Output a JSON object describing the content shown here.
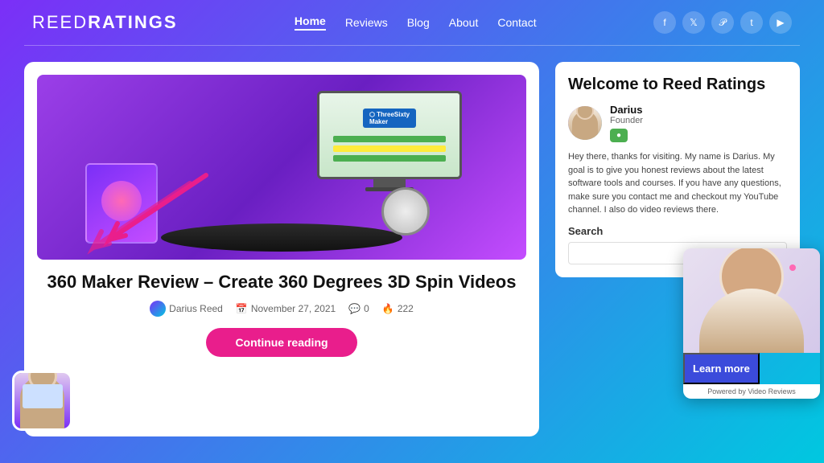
{
  "header": {
    "logo": "ReedRatings",
    "nav": {
      "items": [
        {
          "label": "Home",
          "active": true
        },
        {
          "label": "Reviews",
          "active": false
        },
        {
          "label": "Blog",
          "active": false
        },
        {
          "label": "About",
          "active": false
        },
        {
          "label": "Contact",
          "active": false
        }
      ]
    },
    "social": [
      "f",
      "t",
      "p",
      "t",
      "yt"
    ]
  },
  "article": {
    "title": "360 Maker Review – Create 360 Degrees 3D Spin Videos",
    "author": "Darius Reed",
    "date": "November 27, 2021",
    "comments": "0",
    "views": "222",
    "continue_btn": "Continue reading"
  },
  "sidebar": {
    "welcome_title": "Welcome to Reed Ratings",
    "author_name": "Darius",
    "author_role": "Founder",
    "welcome_text": "Hey there, thanks for visiting. My name is Darius. My goal is to give you honest reviews about the latest software tools and courses. If you have any questions, make sure you contact me and checkout my YouTube channel. I also do video reviews there.",
    "search_label": "Search",
    "search_placeholder": ""
  },
  "video_widget": {
    "learn_more_label": "Learn more",
    "powered_by": "Powered by Video Reviews"
  }
}
